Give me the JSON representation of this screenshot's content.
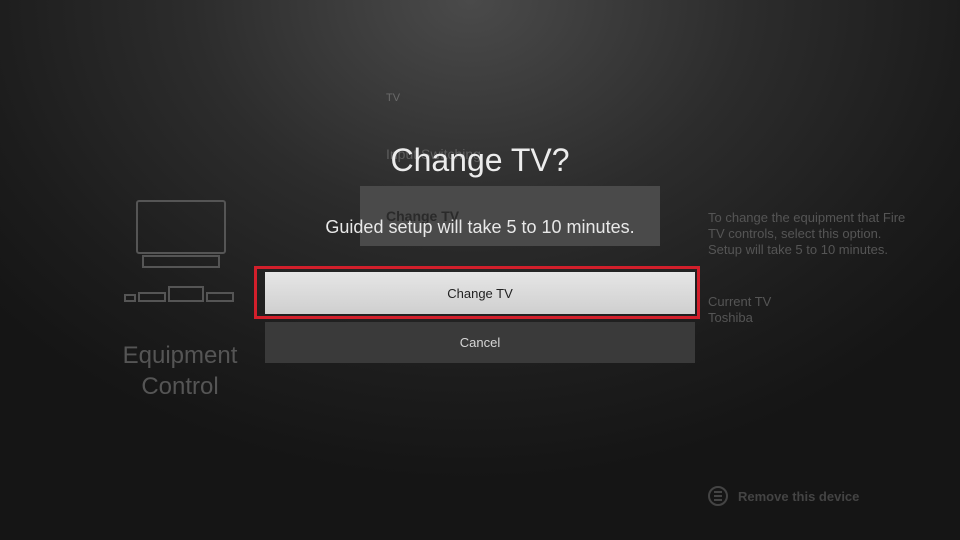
{
  "background": {
    "section_label": "TV",
    "menu_item_top": "Input Switching",
    "menu_item_selected": "Change TV",
    "equipment_title": "Equipment Control",
    "side_description": "To change the equipment that Fire TV controls, select this option. Setup will take 5 to 10 minutes.",
    "current_label": "Current TV",
    "current_value": "Toshiba",
    "remove_device": "Remove this device",
    "menu_icon": "menu-lines-icon"
  },
  "modal": {
    "title": "Change TV?",
    "subtitle": "Guided setup will take 5 to 10 minutes.",
    "primary_button": "Change TV",
    "secondary_button": "Cancel"
  },
  "colors": {
    "highlight": "#d21f2b",
    "primary_button_bg": "#dcdcdc",
    "secondary_button_bg": "#3a3a3a"
  }
}
